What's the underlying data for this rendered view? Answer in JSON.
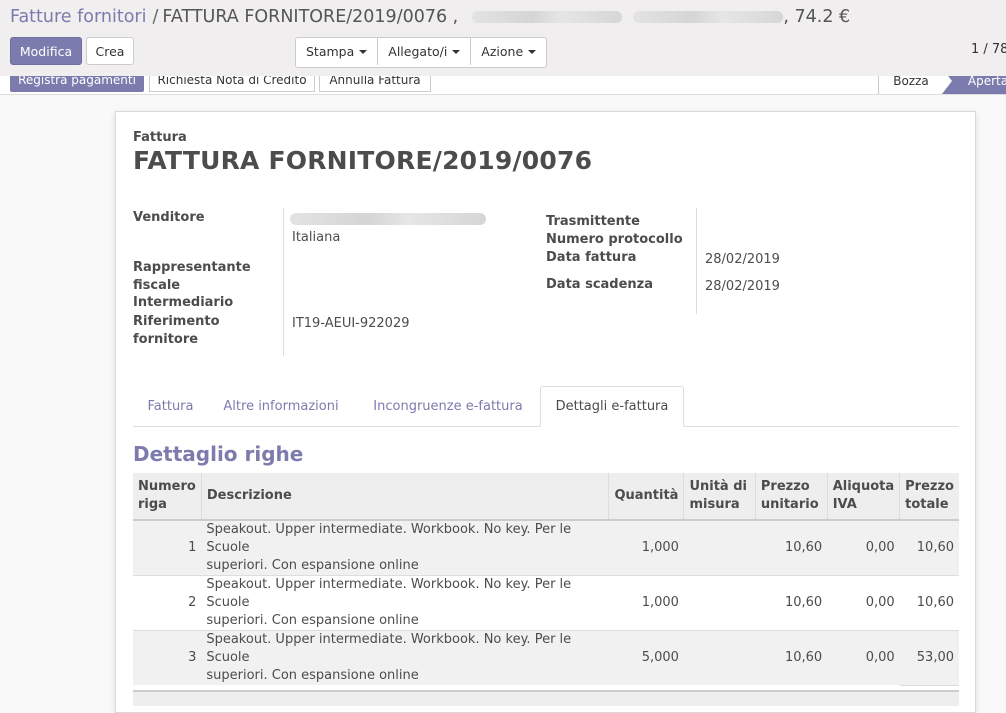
{
  "breadcrumb": {
    "parent": "Fatture fornitori",
    "separator": "/",
    "current_prefix": "FATTURA FORNITORE/2019/0076 ,",
    "current_suffix": ", 74.2 €"
  },
  "toolbar": {
    "edit_label": "Modifica",
    "create_label": "Crea",
    "print_label": "Stampa",
    "attachment_label": "Allegato/i",
    "action_label": "Azione"
  },
  "pager": {
    "text": "1 / 78"
  },
  "statusbar": {
    "register_payment": "Registra pagamenti",
    "credit_note": "Richiesta Nota di Credito",
    "cancel_invoice": "Annulla Fattura",
    "states": [
      "Bozza",
      "Aperta"
    ]
  },
  "document": {
    "kind": "Fattura",
    "number": "FATTURA FORNITORE/2019/0076"
  },
  "fields_left": {
    "vendor_label": "Venditore",
    "vendor_country": "Italiana",
    "fiscal_rep_label_1": "Rappresentante",
    "fiscal_rep_label_2": "fiscale",
    "intermediary_label": "Intermediario",
    "vendor_ref_label_1": "Riferimento",
    "vendor_ref_label_2": "fornitore",
    "vendor_ref_value": "IT19-AEUI-922029"
  },
  "fields_right": {
    "transmitter_label": "Trasmittente",
    "protocol_label": "Numero protocollo",
    "invoice_date_label": "Data fattura",
    "invoice_date_value": "28/02/2019",
    "due_date_label": "Data scadenza",
    "due_date_value": "28/02/2019"
  },
  "tabs": [
    {
      "label": "Fattura",
      "active": false
    },
    {
      "label": "Altre informazioni",
      "active": false
    },
    {
      "label": "Incongruenze e-fattura",
      "active": false
    },
    {
      "label": "Dettagli e-fattura",
      "active": true
    }
  ],
  "lines_section": {
    "title": "Dettaglio righe",
    "columns": {
      "line_no_1": "Numero",
      "line_no_2": "riga",
      "description": "Descrizione",
      "quantity": "Quantità",
      "uom_1": "Unità di",
      "uom_2": "misura",
      "unit_price_1": "Prezzo",
      "unit_price_2": "unitario",
      "vat_1": "Aliquota",
      "vat_2": "IVA",
      "total_1": "Prezzo",
      "total_2": "totale"
    },
    "rows": [
      {
        "no": "1",
        "desc_1": "Speakout. Upper intermediate. Workbook. No key. Per le Scuole",
        "desc_2": "superiori. Con espansione online",
        "qty": "1,000",
        "uom": "",
        "price": "10,60",
        "vat": "0,00",
        "total": "10,60"
      },
      {
        "no": "2",
        "desc_1": "Speakout. Upper intermediate. Workbook. No key. Per le Scuole",
        "desc_2": "superiori. Con espansione online",
        "qty": "1,000",
        "uom": "",
        "price": "10,60",
        "vat": "0,00",
        "total": "10,60"
      },
      {
        "no": "3",
        "desc_1": "Speakout. Upper intermediate. Workbook. No key. Per le Scuole",
        "desc_2": "superiori. Con espansione online",
        "qty": "5,000",
        "uom": "",
        "price": "10,60",
        "vat": "0,00",
        "total": "53,00"
      }
    ]
  },
  "colors": {
    "accent": "#7c7bad",
    "text": "#4c4c4c",
    "panel_bg": "#f0eeee"
  }
}
